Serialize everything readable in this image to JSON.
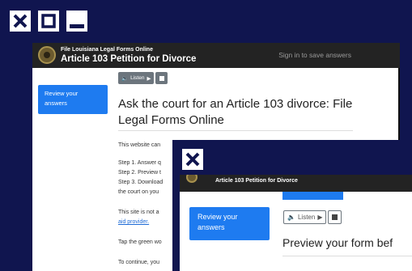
{
  "window_controls": {
    "close": "close-icon",
    "maximize": "maximize-icon",
    "minimize": "minimize-icon"
  },
  "main_window": {
    "header": {
      "site_name": "File Louisiana Legal Forms Online",
      "title": "Article 103 Petition for Divorce",
      "sign_in": "Sign in to save answers"
    },
    "review_button": "Review your answers",
    "listen_label": "Listen",
    "heading": "Ask the court for an Article 103 divorce: File Legal Forms Online",
    "body_lines": [
      "This website can",
      "Step 1. Answer q",
      "Step 2. Preview t",
      "Step 3. Download",
      "the court on you",
      "This site is not a",
      "aid provider.",
      "Tap the green wo",
      "To continue, you"
    ]
  },
  "overlay_window": {
    "header_title": "Article 103 Petition for Divorce",
    "review_button": "Review your answers",
    "listen_label": "Listen",
    "heading": "Preview your form bef"
  },
  "colors": {
    "frame": "#10154f",
    "accent": "#1e7bf0",
    "header": "#232323"
  }
}
